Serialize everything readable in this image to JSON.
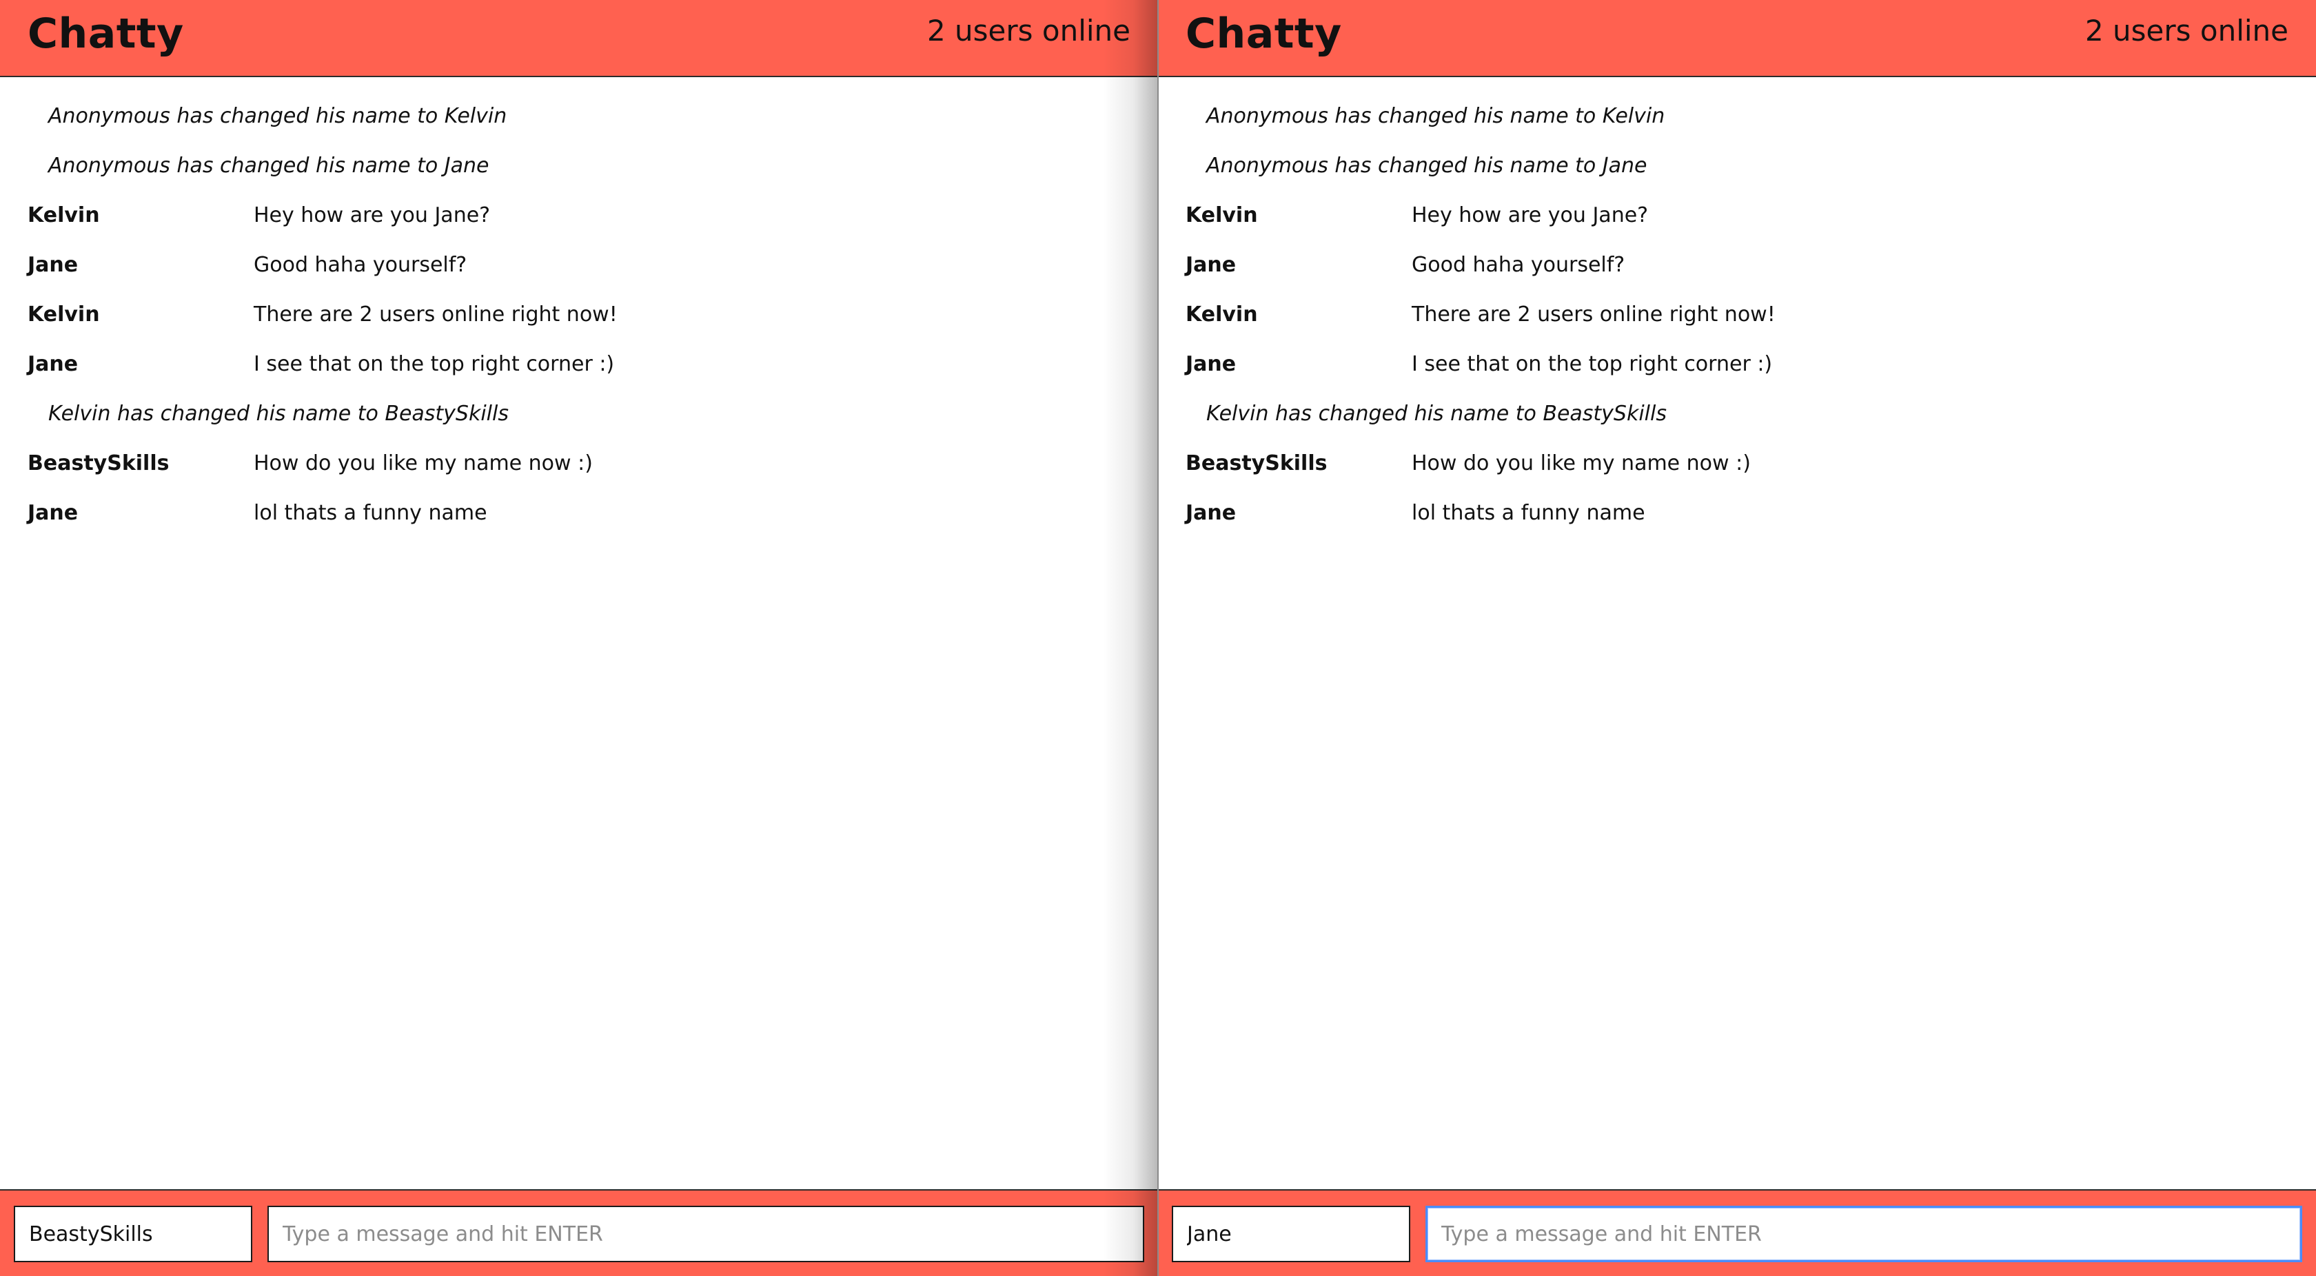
{
  "theme": {
    "accent": "#ff6150",
    "focus_border": "#4a8cf7"
  },
  "panels": [
    {
      "navbar": {
        "brand": "Chatty",
        "users_online": "2 users online"
      },
      "messages": [
        {
          "type": "system",
          "content": "Anonymous has changed his name to Kelvin"
        },
        {
          "type": "system",
          "content": "Anonymous has changed his name to Jane"
        },
        {
          "type": "message",
          "user": "Kelvin",
          "content": "Hey how are you Jane?"
        },
        {
          "type": "message",
          "user": "Jane",
          "content": "Good haha yourself?"
        },
        {
          "type": "message",
          "user": "Kelvin",
          "content": "There are 2 users online right now!"
        },
        {
          "type": "message",
          "user": "Jane",
          "content": "I see that on the top right corner :)"
        },
        {
          "type": "system",
          "content": "Kelvin has changed his name to BeastySkills"
        },
        {
          "type": "message",
          "user": "BeastySkills",
          "content": "How do you like my name now :)"
        },
        {
          "type": "message",
          "user": "Jane",
          "content": "lol thats a funny name"
        }
      ],
      "footer": {
        "username_value": "BeastySkills",
        "message_value": "",
        "message_placeholder": "Type a message and hit ENTER",
        "message_focused": false
      }
    },
    {
      "navbar": {
        "brand": "Chatty",
        "users_online": "2 users online"
      },
      "messages": [
        {
          "type": "system",
          "content": "Anonymous has changed his name to Kelvin"
        },
        {
          "type": "system",
          "content": "Anonymous has changed his name to Jane"
        },
        {
          "type": "message",
          "user": "Kelvin",
          "content": "Hey how are you Jane?"
        },
        {
          "type": "message",
          "user": "Jane",
          "content": "Good haha yourself?"
        },
        {
          "type": "message",
          "user": "Kelvin",
          "content": "There are 2 users online right now!"
        },
        {
          "type": "message",
          "user": "Jane",
          "content": "I see that on the top right corner :)"
        },
        {
          "type": "system",
          "content": "Kelvin has changed his name to BeastySkills"
        },
        {
          "type": "message",
          "user": "BeastySkills",
          "content": "How do you like my name now :)"
        },
        {
          "type": "message",
          "user": "Jane",
          "content": "lol thats a funny name"
        }
      ],
      "footer": {
        "username_value": "Jane",
        "message_value": "",
        "message_placeholder": "Type a message and hit ENTER",
        "message_focused": true
      }
    }
  ]
}
